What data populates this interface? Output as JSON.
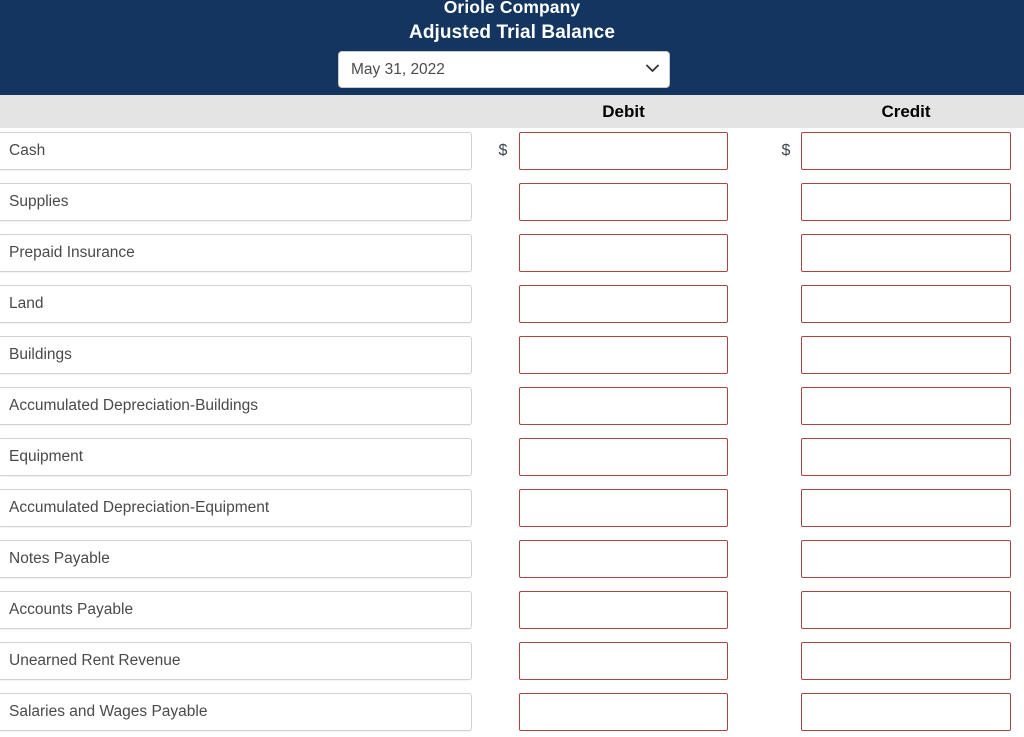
{
  "header": {
    "company_name": "Oriole Company",
    "report_title": "Adjusted Trial Balance",
    "period_selected": "May 31, 2022",
    "period_options": [
      "May 31, 2022"
    ],
    "chevron_icon": "chevron-down-icon",
    "background_color": "#143560",
    "text_color": "#ffffff"
  },
  "columns": {
    "account_header": "",
    "debit_header": "Debit",
    "credit_header": "Credit",
    "band_color": "#e4e4e4"
  },
  "currency_symbol": "$",
  "styles": {
    "amount_border_color": "#a94442",
    "account_border_color": "#d2d2d2"
  },
  "rows": [
    {
      "account": "Cash",
      "show_currency": true,
      "debit_value": "",
      "credit_value": "",
      "debit_placeholder": "",
      "credit_placeholder": ""
    },
    {
      "account": "Supplies",
      "show_currency": false,
      "debit_value": "",
      "credit_value": "",
      "debit_placeholder": "",
      "credit_placeholder": ""
    },
    {
      "account": "Prepaid Insurance",
      "show_currency": false,
      "debit_value": "",
      "credit_value": "",
      "debit_placeholder": "",
      "credit_placeholder": ""
    },
    {
      "account": "Land",
      "show_currency": false,
      "debit_value": "",
      "credit_value": "",
      "debit_placeholder": "",
      "credit_placeholder": ""
    },
    {
      "account": "Buildings",
      "show_currency": false,
      "debit_value": "",
      "credit_value": "",
      "debit_placeholder": "",
      "credit_placeholder": ""
    },
    {
      "account": "Accumulated Depreciation-Buildings",
      "show_currency": false,
      "debit_value": "",
      "credit_value": "",
      "debit_placeholder": "",
      "credit_placeholder": ""
    },
    {
      "account": "Equipment",
      "show_currency": false,
      "debit_value": "",
      "credit_value": "",
      "debit_placeholder": "",
      "credit_placeholder": ""
    },
    {
      "account": "Accumulated Depreciation-Equipment",
      "show_currency": false,
      "debit_value": "",
      "credit_value": "",
      "debit_placeholder": "",
      "credit_placeholder": ""
    },
    {
      "account": "Notes Payable",
      "show_currency": false,
      "debit_value": "",
      "credit_value": "",
      "debit_placeholder": "",
      "credit_placeholder": ""
    },
    {
      "account": "Accounts Payable",
      "show_currency": false,
      "debit_value": "",
      "credit_value": "",
      "debit_placeholder": "",
      "credit_placeholder": ""
    },
    {
      "account": "Unearned Rent Revenue",
      "show_currency": false,
      "debit_value": "",
      "credit_value": "",
      "debit_placeholder": "",
      "credit_placeholder": ""
    },
    {
      "account": "Salaries and Wages Payable",
      "show_currency": false,
      "debit_value": "",
      "credit_value": "",
      "debit_placeholder": "",
      "credit_placeholder": ""
    }
  ]
}
